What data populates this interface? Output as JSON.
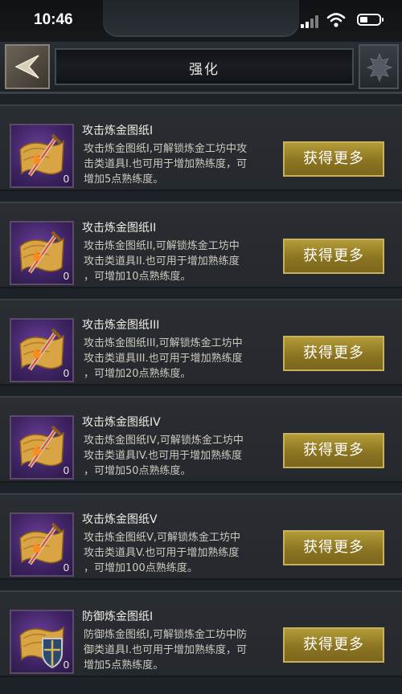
{
  "status_bar": {
    "time": "10:46"
  },
  "header": {
    "title": "强化"
  },
  "items": [
    {
      "name": "攻击炼金图纸I",
      "desc_line1": "攻击炼金图纸I,可解锁炼金工坊中攻",
      "desc_line2": "击类道具I.也可用于增加熟练度，可",
      "desc_line3": "增加5点熟练度。",
      "count": "0",
      "button": "获得更多",
      "icon": "scroll-sword-icon"
    },
    {
      "name": "攻击炼金图纸II",
      "desc_line1": "攻击炼金图纸II,可解锁炼金工坊中",
      "desc_line2": "攻击类道具II.也可用于增加熟练度",
      "desc_line3": "，可增加10点熟练度。",
      "count": "0",
      "button": "获得更多",
      "icon": "scroll-sword-icon"
    },
    {
      "name": "攻击炼金图纸III",
      "desc_line1": "攻击炼金图纸III,可解锁炼金工坊中",
      "desc_line2": "攻击类道具III.也可用于增加熟练度",
      "desc_line3": "，可增加20点熟练度。",
      "count": "0",
      "button": "获得更多",
      "icon": "scroll-sword-icon"
    },
    {
      "name": "攻击炼金图纸IV",
      "desc_line1": "攻击炼金图纸IV,可解锁炼金工坊中",
      "desc_line2": "攻击类道具IV.也可用于增加熟练度",
      "desc_line3": "，可增加50点熟练度。",
      "count": "0",
      "button": "获得更多",
      "icon": "scroll-sword-icon"
    },
    {
      "name": "攻击炼金图纸V",
      "desc_line1": "攻击炼金图纸V,可解锁炼金工坊中",
      "desc_line2": "攻击类道具V.也可用于增加熟练度",
      "desc_line3": "，可增加100点熟练度。",
      "count": "0",
      "button": "获得更多",
      "icon": "scroll-sword-icon"
    },
    {
      "name": "防御炼金图纸I",
      "desc_line1": "防御炼金图纸I,可解锁炼金工坊中防",
      "desc_line2": "御类道具I.也可用于增加熟练度，可",
      "desc_line3": "增加5点熟练度。",
      "count": "0",
      "button": "获得更多",
      "icon": "scroll-shield-icon"
    }
  ],
  "colors": {
    "accent_gold": "#a58c2f",
    "icon_bg_purple": "#4b2a74",
    "panel": "#272b30"
  }
}
